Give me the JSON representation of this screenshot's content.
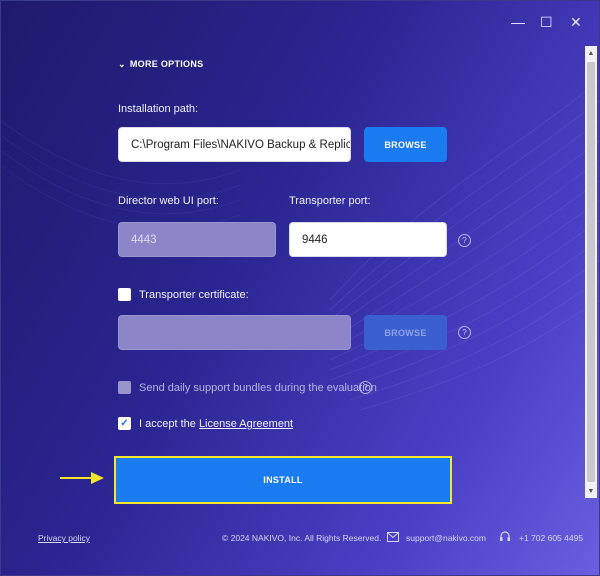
{
  "window": {
    "minimize": "—",
    "maximize": "☐",
    "close": "✕"
  },
  "more_options": "MORE OPTIONS",
  "install_path": {
    "label": "Installation path:",
    "value": "C:\\Program Files\\NAKIVO Backup & Replicat",
    "browse": "BROWSE"
  },
  "director_port": {
    "label": "Director web UI port:",
    "value": "4443"
  },
  "transporter_port": {
    "label": "Transporter port:",
    "value": "9446"
  },
  "transporter_cert": {
    "label": "Transporter certificate:",
    "value": "",
    "browse": "BROWSE"
  },
  "support_bundles": {
    "label": "Send daily support bundles during the evaluation"
  },
  "license": {
    "prefix": "I accept the ",
    "link": "License Agreement",
    "checked": true
  },
  "install_button": "INSTALL",
  "footer": {
    "privacy": "Privacy policy",
    "copyright": "© 2024 NAKIVO, Inc. All Rights Reserved.",
    "email": "support@nakivo.com",
    "phone": "+1 702 605 4495"
  },
  "colors": {
    "accent": "#1a7cf0",
    "highlight": "#f2e52a"
  }
}
